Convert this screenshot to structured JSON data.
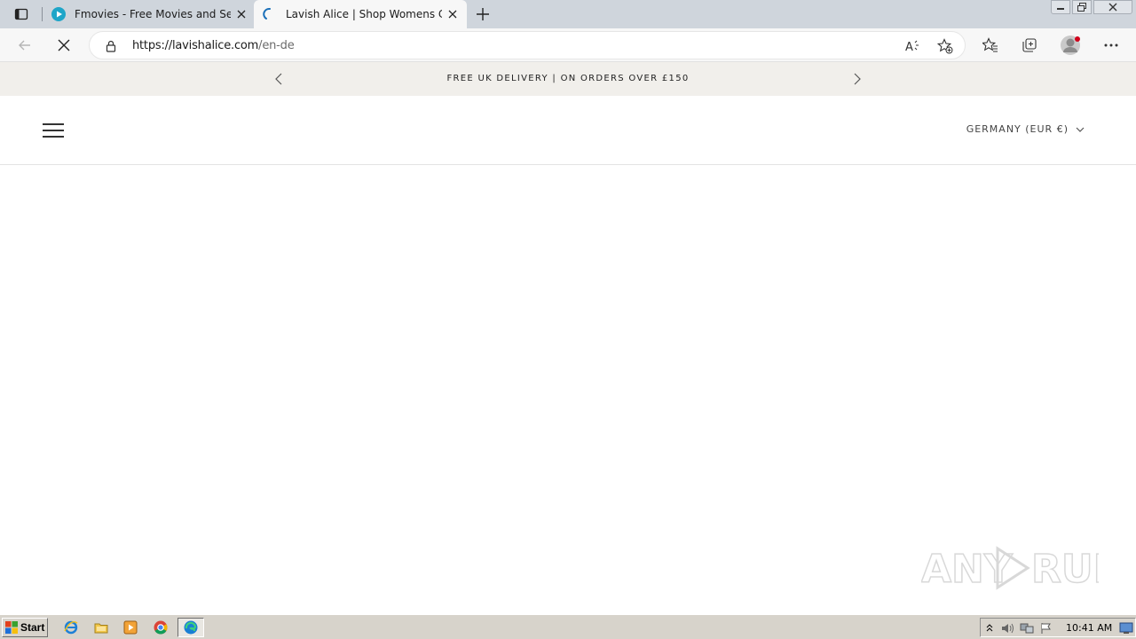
{
  "browser": {
    "tabs": [
      {
        "title": "Fmovies - Free Movies and Series",
        "active": false
      },
      {
        "title": "Lavish Alice | Shop Womens Clot",
        "active": true
      }
    ],
    "address": {
      "host": "https://lavishalice.com",
      "path": "/en-de"
    }
  },
  "site": {
    "announcement": "FREE UK DELIVERY | ON ORDERS OVER £150",
    "country_selector": "GERMANY (EUR €)"
  },
  "watermark": {
    "text": "ANY RUN"
  },
  "taskbar": {
    "start_label": "Start",
    "clock": "10:41 AM"
  },
  "colors": {
    "announcement_bg": "#f1efeb",
    "tabstrip_bg": "#cfd5dc",
    "taskbar_bg": "#d7d3cb",
    "edge_blue": "#1a7fd4"
  }
}
